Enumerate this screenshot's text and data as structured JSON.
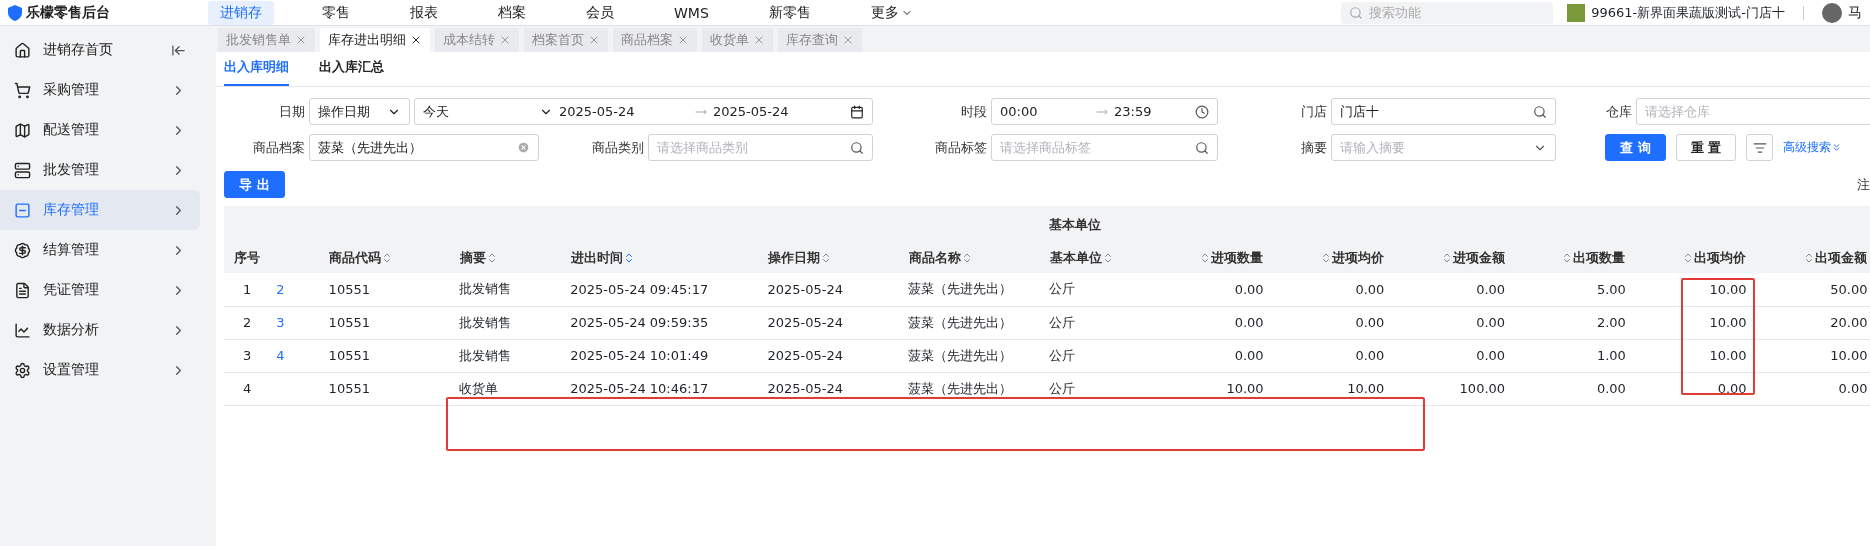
{
  "topbar": {
    "logo": "乐檬零售后台",
    "nav": [
      {
        "label": "进销存",
        "selected": true
      },
      {
        "label": "零售",
        "selected": false
      },
      {
        "label": "报表",
        "selected": false
      },
      {
        "label": "档案",
        "selected": false
      },
      {
        "label": "会员",
        "selected": false
      },
      {
        "label": "WMS",
        "selected": false
      },
      {
        "label": "新零售",
        "selected": false
      },
      {
        "label": "更多",
        "selected": false,
        "kind": "menu"
      }
    ],
    "search_placeholder": "搜索功能",
    "store": "99661-新界面果蔬版测试-门店十",
    "user": "马"
  },
  "sidebar": {
    "items": [
      {
        "label": "进销存首页",
        "selected": false,
        "kind": "home"
      },
      {
        "label": "采购管理",
        "selected": false,
        "kind": "group"
      },
      {
        "label": "配送管理",
        "selected": false,
        "kind": "group"
      },
      {
        "label": "批发管理",
        "selected": false,
        "kind": "group"
      },
      {
        "label": "库存管理",
        "selected": true,
        "kind": "group"
      },
      {
        "label": "结算管理",
        "selected": false,
        "kind": "group"
      },
      {
        "label": "凭证管理",
        "selected": false,
        "kind": "group"
      },
      {
        "label": "数据分析",
        "selected": false,
        "kind": "group"
      },
      {
        "label": "设置管理",
        "selected": false,
        "kind": "group"
      }
    ]
  },
  "tabs": [
    {
      "label": "批发销售单",
      "selected": false
    },
    {
      "label": "库存进出明细",
      "selected": true
    },
    {
      "label": "成本结转",
      "selected": false
    },
    {
      "label": "档案首页",
      "selected": false
    },
    {
      "label": "商品档案",
      "selected": false
    },
    {
      "label": "收货单",
      "selected": false
    },
    {
      "label": "库存查询",
      "selected": false
    }
  ],
  "subtabs": [
    {
      "label": "出入库明细",
      "selected": true
    },
    {
      "label": "出入库汇总",
      "selected": false
    }
  ],
  "filters": [
    {
      "label": "日期",
      "kind": "date",
      "mode": "操作日期",
      "preset": "今天",
      "from": "2025-05-24",
      "to": "2025-05-24"
    },
    {
      "label": "时段",
      "kind": "range",
      "from": "00:00",
      "to": "23:59"
    },
    {
      "label": "门店",
      "kind": "search",
      "value": "门店十"
    },
    {
      "label": "仓库",
      "kind": "text",
      "placeholder": "请选择仓库"
    },
    {
      "label": "商品档案",
      "kind": "clear",
      "value": "菠菜（先进先出）"
    },
    {
      "label": "商品类别",
      "kind": "search",
      "placeholder": "请选择商品类别"
    },
    {
      "label": "商品标签",
      "kind": "search",
      "placeholder": "请选择商品标签"
    },
    {
      "label": "摘要",
      "kind": "dropdown",
      "placeholder": "请输入摘要"
    }
  ],
  "actions": {
    "query": "查 询",
    "reset": "重 置",
    "advanced": "高级搜索"
  },
  "export": "导 出",
  "note": "注",
  "table": {
    "group_header": "基本单位",
    "columns": [
      {
        "label": "序号",
        "kind": "index"
      },
      {
        "kind": "link"
      },
      {
        "label": "商品代码",
        "kind": "text",
        "sorted": false
      },
      {
        "label": "摘要",
        "kind": "text",
        "sorted": false
      },
      {
        "label": "进出时间",
        "kind": "text",
        "sorted": true
      },
      {
        "label": "操作日期",
        "kind": "text",
        "sorted": false
      },
      {
        "label": "商品名称",
        "kind": "text",
        "sorted": false
      },
      {
        "label": "基本单位",
        "kind": "text",
        "sorted": false
      },
      {
        "label": "进项数量",
        "kind": "number",
        "sorted": false
      },
      {
        "label": "进项均价",
        "kind": "number",
        "sorted": false
      },
      {
        "label": "进项金额",
        "kind": "number",
        "sorted": false
      },
      {
        "label": "出项数量",
        "kind": "number",
        "sorted": false
      },
      {
        "label": "出项均价",
        "kind": "number",
        "sorted": false
      },
      {
        "label": "出项金额",
        "kind": "number",
        "sorted": false
      }
    ],
    "rows": [
      [
        "1",
        "2",
        "10551",
        "批发销售",
        "2025-05-24 09:45:17",
        "2025-05-24",
        "菠菜（先进先出）",
        "公斤",
        "0.00",
        "0.00",
        "0.00",
        "5.00",
        "10.00",
        "50.00"
      ],
      [
        "2",
        "3",
        "10551",
        "批发销售",
        "2025-05-24 09:59:35",
        "2025-05-24",
        "菠菜（先进先出）",
        "公斤",
        "0.00",
        "0.00",
        "0.00",
        "2.00",
        "10.00",
        "20.00"
      ],
      [
        "3",
        "4",
        "10551",
        "批发销售",
        "2025-05-24 10:01:49",
        "2025-05-24",
        "菠菜（先进先出）",
        "公斤",
        "0.00",
        "0.00",
        "0.00",
        "1.00",
        "10.00",
        "10.00"
      ],
      [
        "4",
        null,
        "10551",
        "收货单",
        "2025-05-24 10:46:17",
        "2025-05-24",
        "菠菜（先进先出）",
        "公斤",
        "10.00",
        "10.00",
        "100.00",
        "0.00",
        "0.00",
        "0.00"
      ]
    ]
  }
}
